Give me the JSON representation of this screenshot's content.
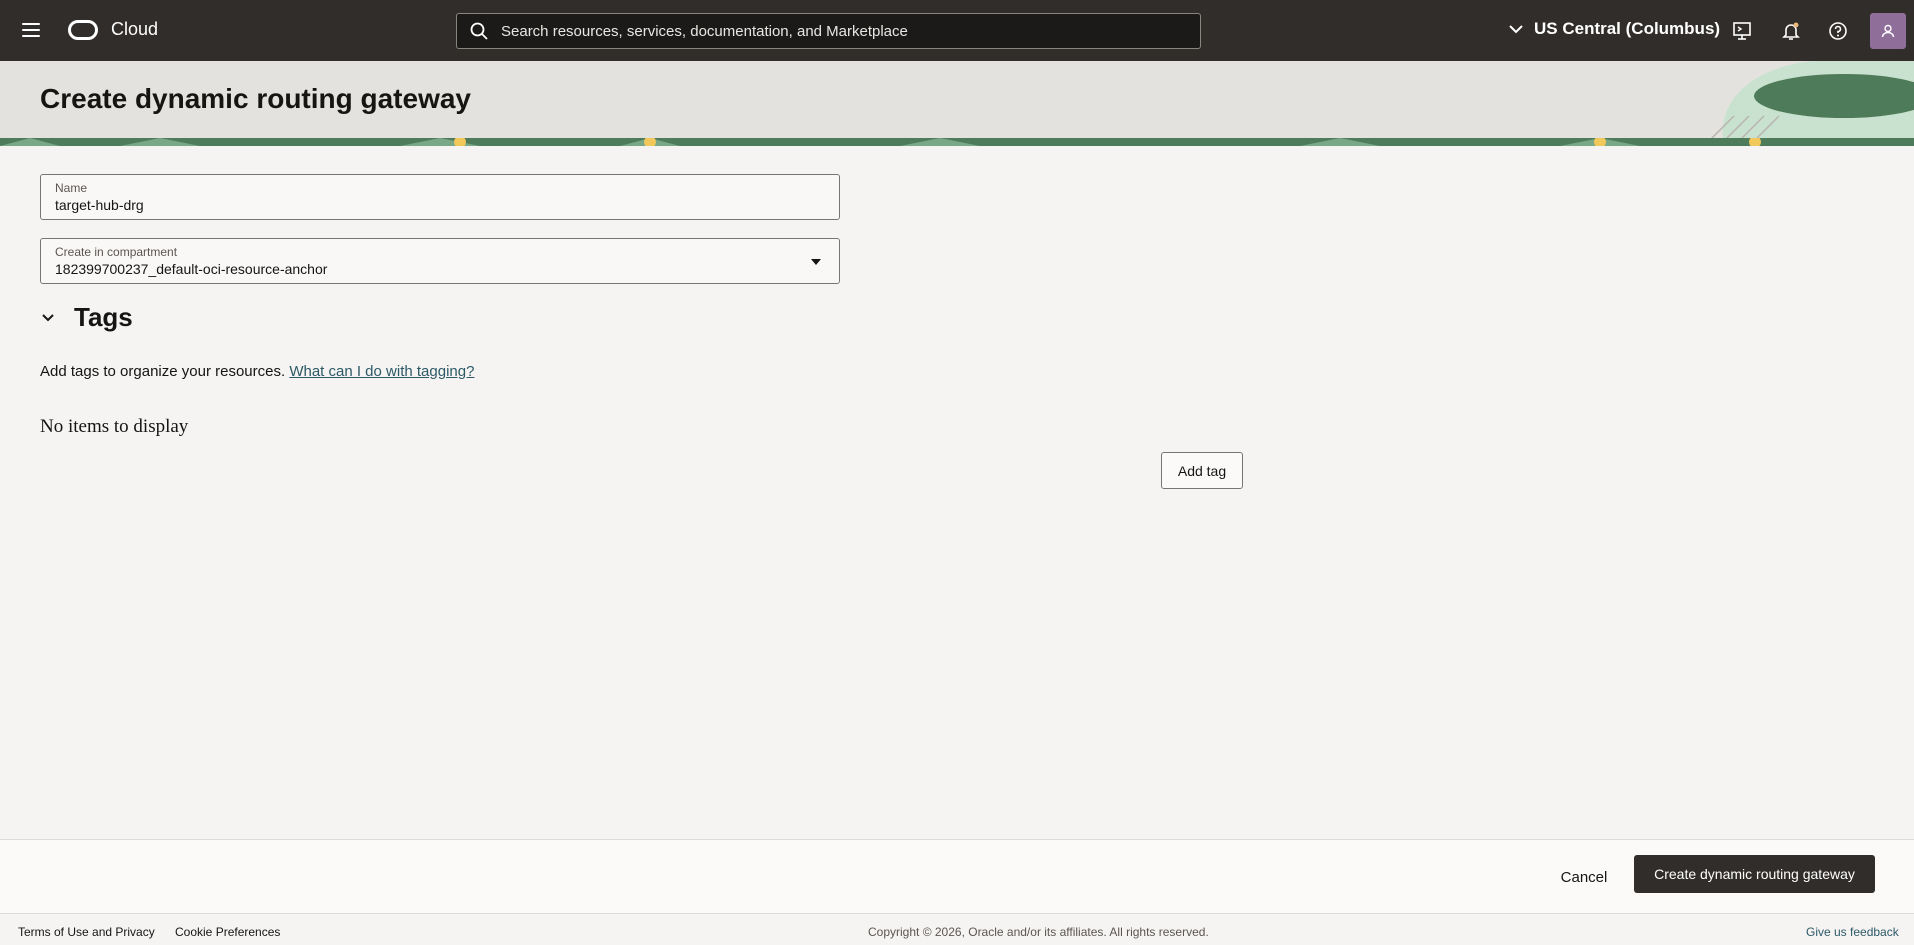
{
  "topbar": {
    "brand": "Cloud",
    "search_placeholder": "Search resources, services, documentation, and Marketplace",
    "region": "US Central (Columbus)"
  },
  "page": {
    "title": "Create dynamic routing gateway"
  },
  "form": {
    "name_label": "Name",
    "name_value": "target-hub-drg",
    "compartment_label": "Create in compartment",
    "compartment_value": "182399700237_default-oci-resource-anchor"
  },
  "tags": {
    "heading": "Tags",
    "description": "Add tags to organize your resources.",
    "help_link": "What can I do with tagging?",
    "empty_text": "No items to display",
    "add_button": "Add tag"
  },
  "actions": {
    "cancel": "Cancel",
    "submit": "Create dynamic routing gateway"
  },
  "footer": {
    "terms": "Terms of Use and Privacy",
    "cookies": "Cookie Preferences",
    "copyright": "Copyright © 2026, Oracle and/or its affiliates. All rights reserved.",
    "feedback": "Give us feedback"
  },
  "colors": {
    "topbar": "#312d2a",
    "primary_button": "#312d2a",
    "link": "#2d5967",
    "accent_stripe": "#4e7b5a"
  }
}
